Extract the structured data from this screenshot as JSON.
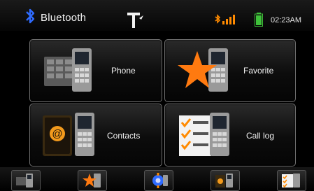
{
  "status": {
    "title": "Bluetooth",
    "time": "02:23AM",
    "icons": [
      "bluetooth-icon",
      "antenna-icon",
      "signal-strength-icon",
      "battery-icon"
    ],
    "colors": {
      "bluetooth": "#2f6bff",
      "status_orange": "#ff8a00",
      "battery": "#3fc23a"
    }
  },
  "tiles": [
    {
      "label": "Phone",
      "icon": "phone-keypad-icon"
    },
    {
      "label": "Favorite",
      "icon": "star-icon"
    },
    {
      "label": "Contacts",
      "icon": "address-book-icon"
    },
    {
      "label": "Call log",
      "icon": "call-log-icon"
    }
  ],
  "dock": [
    {
      "icon": "phone-keypad-icon"
    },
    {
      "icon": "star-icon"
    },
    {
      "icon": "settings-gear-icon"
    },
    {
      "icon": "address-book-icon"
    },
    {
      "icon": "call-log-icon"
    }
  ]
}
